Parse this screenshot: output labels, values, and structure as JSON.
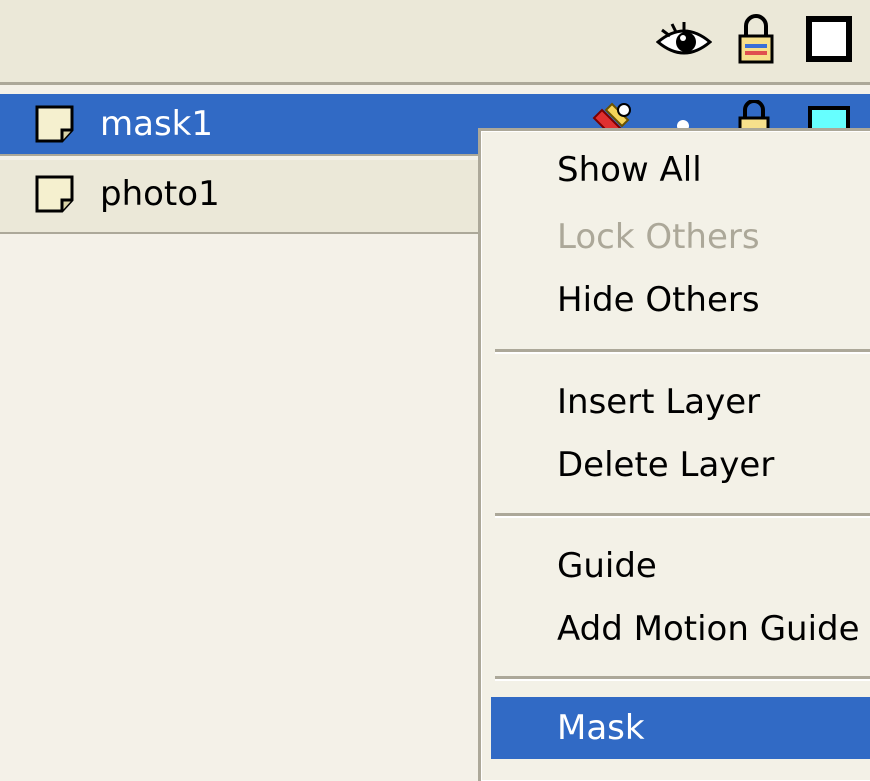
{
  "header": {
    "icons": [
      "eye-icon",
      "lock-icon",
      "outline-icon"
    ]
  },
  "layers": [
    {
      "name": "mask1",
      "selected": true,
      "icons": [
        "pencil-icon",
        "dot-icon",
        "lock-icon",
        "outline-color-icon"
      ],
      "outline_color": "#66ffff"
    },
    {
      "name": "photo1",
      "selected": false
    }
  ],
  "context_menu": {
    "items": [
      {
        "label": "Show All",
        "enabled": true
      },
      {
        "label": "Lock Others",
        "enabled": false
      },
      {
        "label": "Hide Others",
        "enabled": true
      },
      {
        "label": "Insert Layer",
        "enabled": true
      },
      {
        "label": "Delete Layer",
        "enabled": true
      },
      {
        "label": "Guide",
        "enabled": true
      },
      {
        "label": "Add Motion Guide",
        "enabled": true
      },
      {
        "label": "Mask",
        "enabled": true,
        "highlighted": true
      }
    ]
  },
  "colors": {
    "selection": "#316ac5",
    "panel": "#ebe8d8",
    "disabled_text": "#aca899"
  }
}
